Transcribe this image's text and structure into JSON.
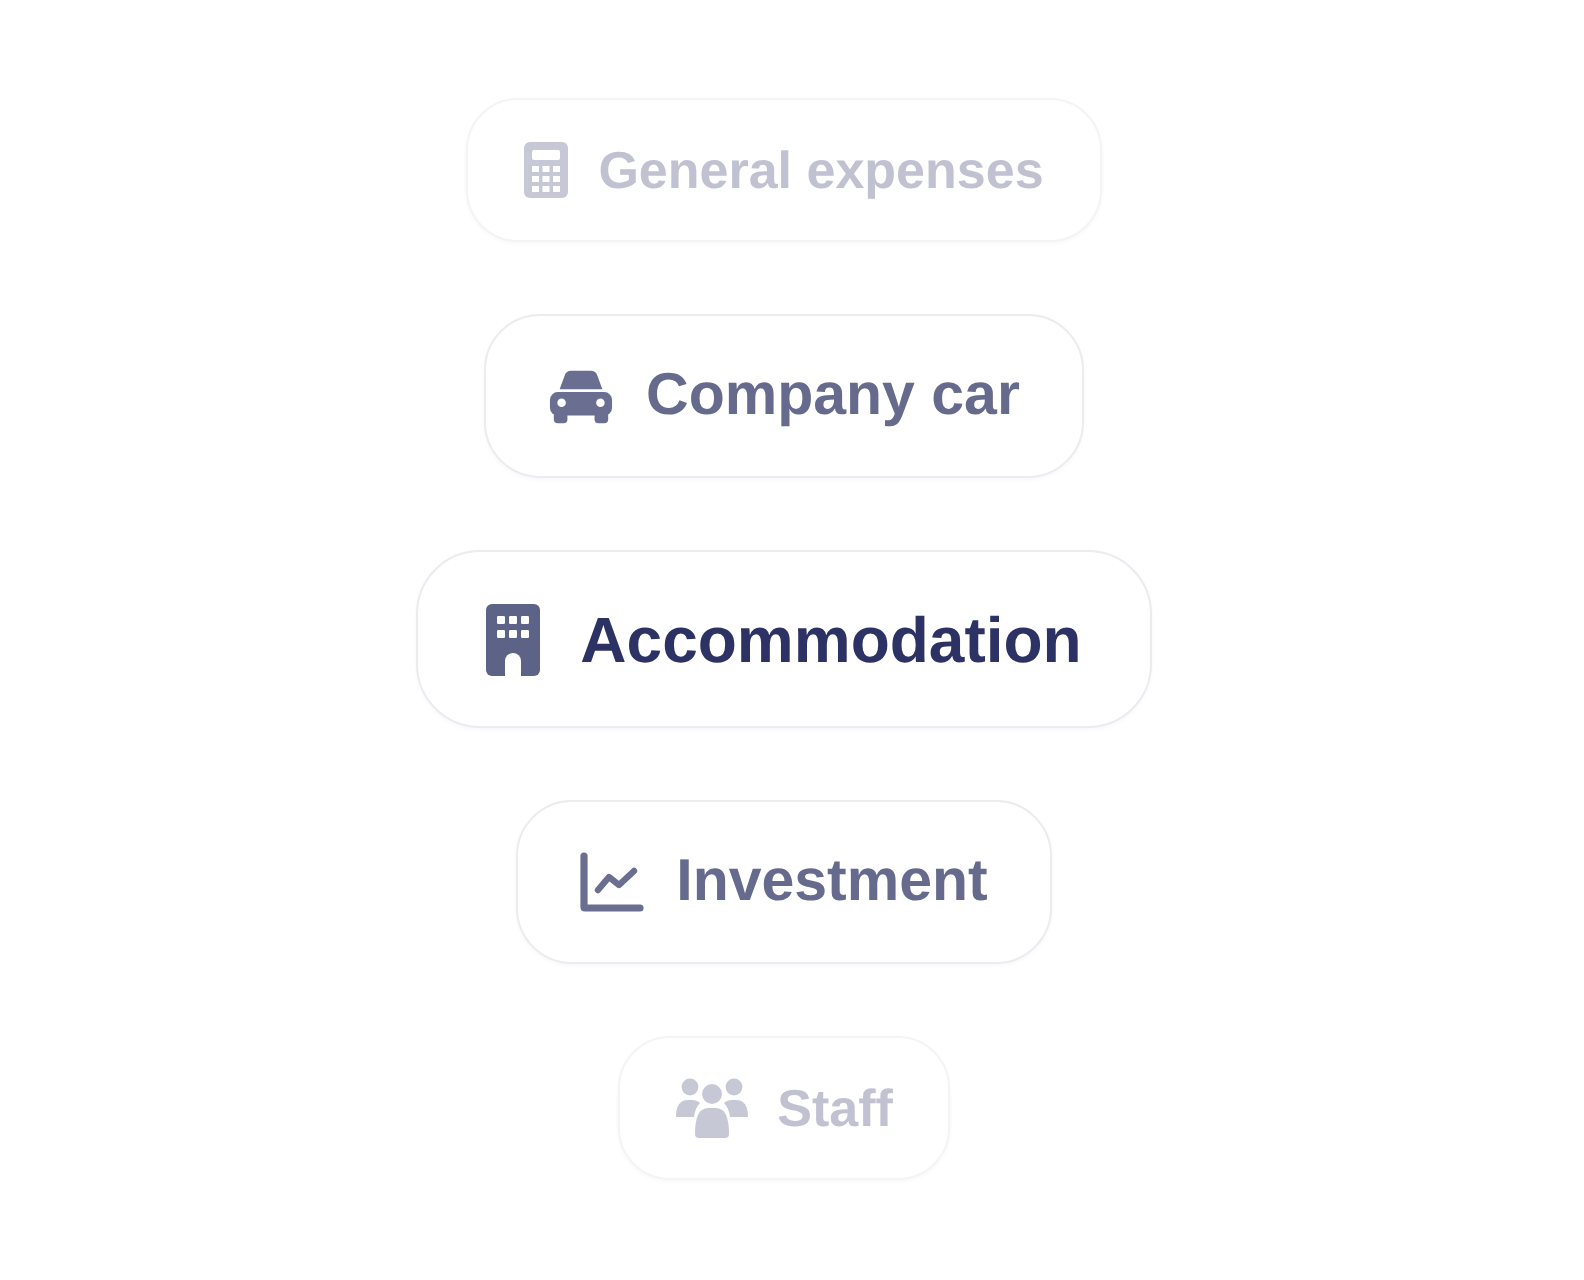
{
  "picker": {
    "items": [
      {
        "label": "General expenses",
        "selected": false
      },
      {
        "label": "Company car",
        "selected": false
      },
      {
        "label": "Accommodation",
        "selected": true
      },
      {
        "label": "Investment",
        "selected": false
      },
      {
        "label": "Staff",
        "selected": false
      }
    ]
  }
}
